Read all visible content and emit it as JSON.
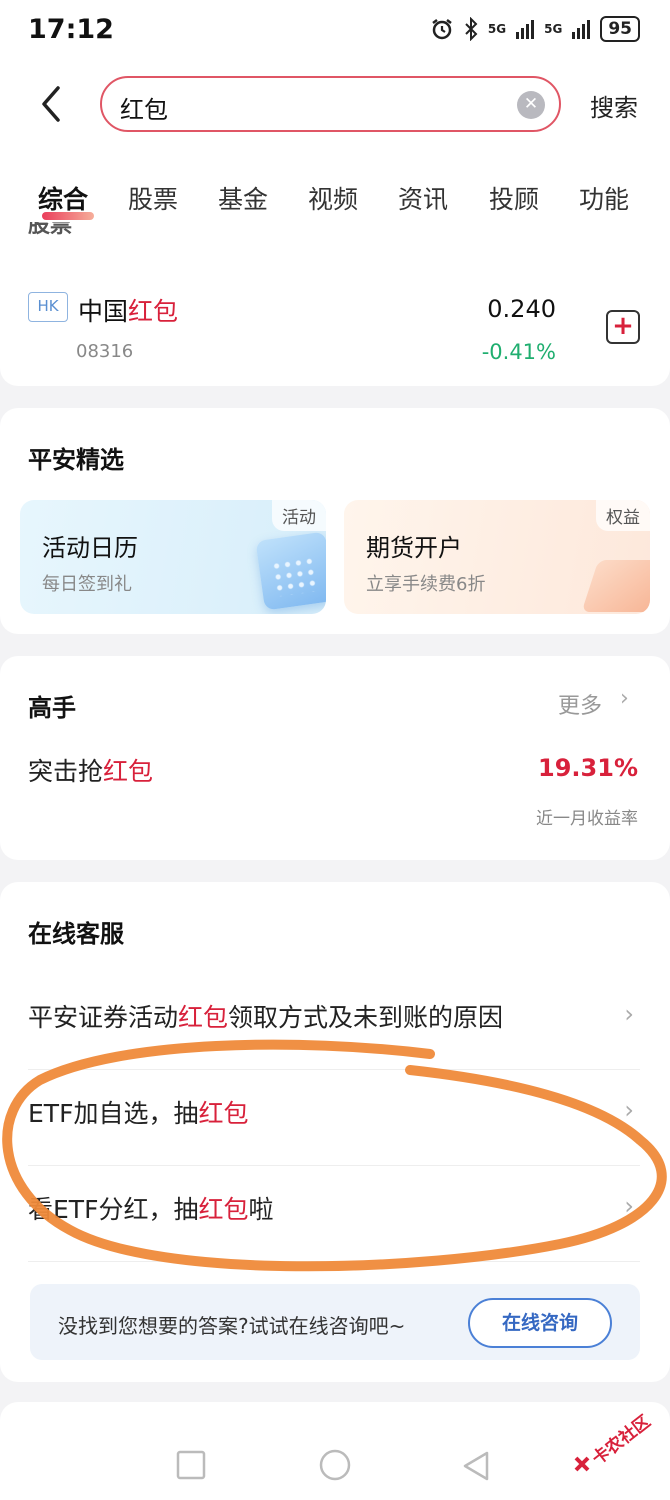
{
  "status_bar": {
    "time": "17:12",
    "net1": "5G",
    "net2": "5G",
    "battery": "95"
  },
  "search": {
    "query": "红包",
    "button": "搜索"
  },
  "tabs": [
    "综合",
    "股票",
    "基金",
    "视频",
    "资讯",
    "投顾",
    "功能"
  ],
  "stock_section": {
    "header_partial": "股票",
    "market": "HK",
    "name_prefix": "中国",
    "name_highlight": "红包",
    "code": "08316",
    "price": "0.240",
    "change": "-0.41%"
  },
  "pingan": {
    "title": "平安精选",
    "tiles": [
      {
        "title": "活动日历",
        "subtitle": "每日签到礼",
        "tag": "活动"
      },
      {
        "title": "期货开户",
        "subtitle": "立享手续费6折",
        "tag": "权益"
      }
    ]
  },
  "expert": {
    "title": "高手",
    "more": "更多",
    "name_prefix": "突击抢",
    "name_highlight": "红包",
    "return": "19.31%",
    "return_label": "近一月收益率"
  },
  "service": {
    "title": "在线客服",
    "faqs": [
      {
        "pre": "平安证券活动",
        "hl": "红包",
        "post": "领取方式及未到账的原因"
      },
      {
        "pre": "ETF加自选，抽",
        "hl": "红包",
        "post": ""
      },
      {
        "pre": "看ETF分红，抽",
        "hl": "红包",
        "post": "啦"
      }
    ],
    "prompt": "没找到您想要的答案?试试在线咨询吧~",
    "consult_button": "在线咨询"
  },
  "watermark": "卡农社区",
  "colors": {
    "highlight": "#d8213b",
    "up_green": "#1fae6f",
    "annotation_orange": "#ef8a3a",
    "consult_blue": "#4b80d6"
  }
}
